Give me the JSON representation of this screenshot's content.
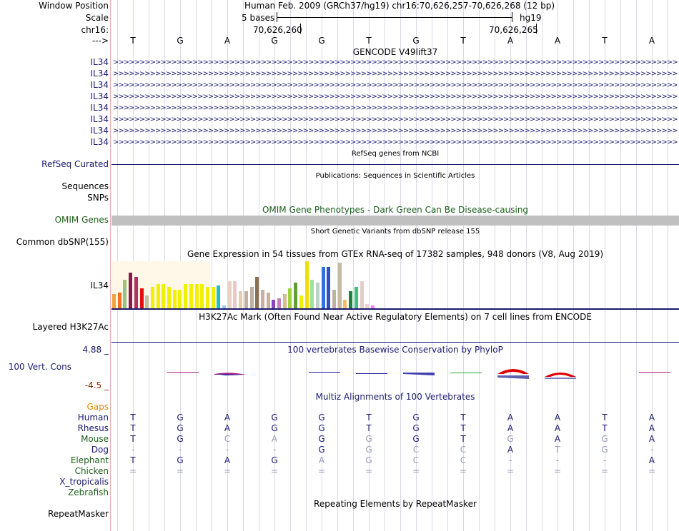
{
  "header": {
    "window_position_label": "Window Position",
    "window_position_value": "Human Feb. 2009 (GRCh37/hg19)   chr16:70,626,257-70,626,268 (12 bp)",
    "scale_label": "Scale",
    "scale_text": "5 bases",
    "scale_assembly": "hg19",
    "chrom_label": "chr16:",
    "pos1": "70,626,260",
    "pos2": "70,626,265",
    "strand_label": "--->"
  },
  "sequence": [
    "T",
    "G",
    "A",
    "G",
    "G",
    "T",
    "G",
    "T",
    "A",
    "A",
    "T",
    "A"
  ],
  "gencode": {
    "title": "GENCODE V49lift37",
    "gene_labels": [
      "IL34",
      "IL34",
      "IL34",
      "IL34",
      "IL34",
      "IL34",
      "IL34",
      "IL34"
    ],
    "arrow_text": ">>>>>>>>>>>>>>>>>>>>>>>>>>>>>>>>>>>>>>>>>>>>>>>>>>>>>>>>>>>>>>>>>>>>>>>>>>>>>>>>>>>>>>>>>>>>>>>>>>>>>>>>>>>>>>>>>>>>>>>>>>>>>>>>>>>>>>>>>>>"
  },
  "refseq": {
    "title": "RefSeq genes from NCBI",
    "label": "RefSeq Curated"
  },
  "publications": {
    "title": "Publications: Sequences in Scientific Articles",
    "label1": "Sequences",
    "label2": "SNPs"
  },
  "omim": {
    "title": "OMIM Gene Phenotypes - Dark Green Can Be Disease-causing",
    "label": "OMIM Genes"
  },
  "dbsnp": {
    "title": "Short Genetic Variants from dbSNP release 155",
    "label": "Common dbSNP(155)"
  },
  "gtex": {
    "title": "Gene Expression in 54 tissues from GTEx RNA-seq of 17382 samples, 948 donors (V8, Aug 2019)",
    "label": "IL34"
  },
  "h3k27ac": {
    "title": "H3K27Ac Mark (Often Found Near Active Regulatory Elements) on 7 cell lines from ENCODE",
    "label": "Layered H3K27Ac"
  },
  "phylop": {
    "title": "100 vertebrates Basewise Conservation by PhyloP",
    "label": "100 Vert. Cons",
    "max": "4.88 _",
    "min": "-4.5 _"
  },
  "multiz": {
    "title": "Multiz Alignments of 100 Vertebrates",
    "gaps_label": "Gaps",
    "species": [
      {
        "name": "Human",
        "bases": [
          "T",
          "G",
          "A",
          "G",
          "G",
          "T",
          "G",
          "T",
          "A",
          "A",
          "T",
          "A"
        ]
      },
      {
        "name": "Rhesus",
        "bases": [
          "T",
          "G",
          "A",
          "G",
          "G",
          "T",
          "G",
          "T",
          "A",
          "A",
          "T",
          "A"
        ]
      },
      {
        "name": "Mouse",
        "bases": [
          "T",
          "G",
          "C",
          "A",
          "G",
          "G",
          "G",
          "T",
          "G",
          "A",
          "G",
          "A"
        ]
      },
      {
        "name": "Dog",
        "bases": [
          "-",
          "-",
          "-",
          "-",
          "G",
          "G",
          "C",
          "C",
          "A",
          "T",
          "G",
          "-"
        ]
      },
      {
        "name": "Elephant",
        "bases": [
          "T",
          "G",
          "A",
          "G",
          "A",
          "G",
          "C",
          "C",
          "-",
          "-",
          "-",
          "A"
        ]
      },
      {
        "name": "Chicken",
        "bases": [
          "=",
          "=",
          "=",
          "=",
          "=",
          "=",
          "=",
          "=",
          "=",
          "=",
          "=",
          "="
        ]
      },
      {
        "name": "X_tropicalis",
        "bases": []
      },
      {
        "name": "Zebrafish",
        "bases": []
      }
    ]
  },
  "repeatmasker": {
    "title": "Repeating Elements by RepeatMasker",
    "label": "RepeatMasker"
  },
  "colors": {
    "navy": "#1a1a6e",
    "green": "#1b5e1b",
    "omim_bar": "#c0c0c0"
  }
}
